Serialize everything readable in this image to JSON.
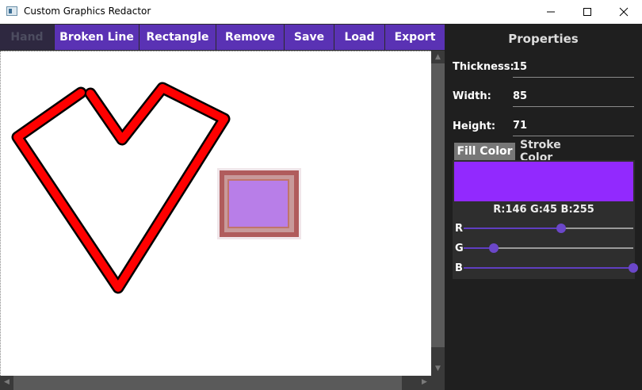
{
  "window": {
    "title": "Custom Graphics Redactor",
    "icon": "app-window-icon",
    "controls": [
      "minimize-icon",
      "maximize-icon",
      "close-icon"
    ]
  },
  "toolbar": {
    "hand": "Hand",
    "broken_line": "Broken Line",
    "rectangle": "Rectangle",
    "remove": "Remove",
    "save": "Save",
    "load": "Load",
    "export": "Export"
  },
  "canvas": {
    "shapes": [
      {
        "type": "broken-line",
        "stroke": "#000000",
        "fill": "#ff0000"
      },
      {
        "type": "rectangle",
        "stroke": "#b06060",
        "fill": "#b87ee8"
      }
    ]
  },
  "properties": {
    "title": "Properties",
    "thickness_label": "Thickness:",
    "thickness_value": "15",
    "width_label": "Width:",
    "width_value": "85",
    "height_label": "Height:",
    "height_value": "71",
    "tabs": {
      "fill": "Fill Color",
      "stroke": "Stroke Color"
    },
    "color": {
      "hex": "#9229fe",
      "text": "R:146 G:45 B:255",
      "r_label": "R",
      "g_label": "G",
      "b_label": "B",
      "r": 146,
      "g": 45,
      "b": 255
    }
  },
  "colors": {
    "accent": "#5a32b4",
    "panel_bg": "#1f1f1f"
  }
}
